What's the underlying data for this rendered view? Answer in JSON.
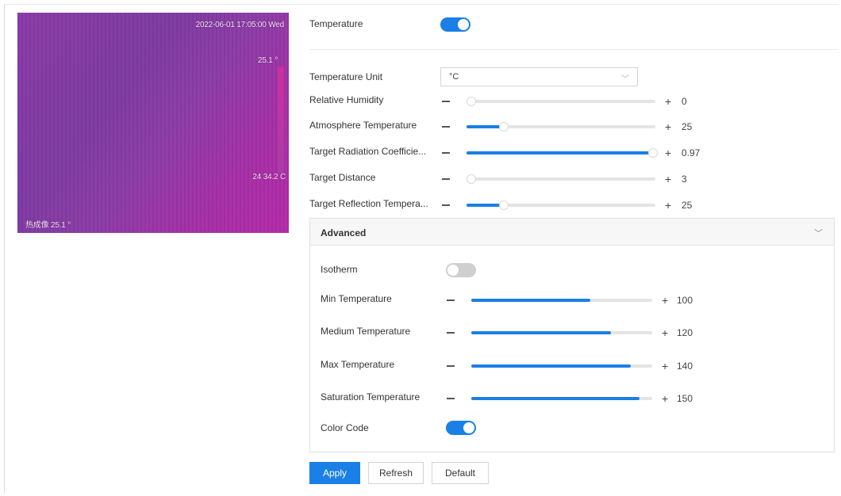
{
  "preview": {
    "timestamp": "2022-06-01 17:05:00 Wed",
    "max_reading": "25.1 °",
    "min_reading": "24 34.2 C",
    "point_label": "热成像 25.1 °"
  },
  "temperature": {
    "label": "Temperature",
    "enabled": true
  },
  "unit": {
    "label": "Temperature Unit",
    "value": "°C"
  },
  "sliders": [
    {
      "label": "Relative Humidity",
      "value": "0",
      "fraction": 0.0
    },
    {
      "label": "Atmosphere Temperature",
      "value": "25",
      "fraction": 0.18
    },
    {
      "label": "Target Radiation Coefficie...",
      "value": "0.97",
      "fraction": 0.97
    },
    {
      "label": "Target Distance",
      "value": "3",
      "fraction": 0.0
    },
    {
      "label": "Target Reflection Tempera...",
      "value": "25",
      "fraction": 0.18
    }
  ],
  "advanced": {
    "title": "Advanced",
    "isotherm": {
      "label": "Isotherm",
      "enabled": false
    },
    "sliders": [
      {
        "label": "Min Temperature",
        "value": "100",
        "fraction": 0.66
      },
      {
        "label": "Medium Temperature",
        "value": "120",
        "fraction": 0.77
      },
      {
        "label": "Max Temperature",
        "value": "140",
        "fraction": 0.88
      },
      {
        "label": "Saturation Temperature",
        "value": "150",
        "fraction": 0.93
      }
    ],
    "color_code": {
      "label": "Color Code",
      "enabled": true
    }
  },
  "buttons": {
    "apply": "Apply",
    "refresh": "Refresh",
    "default": "Default"
  },
  "colors": {
    "accent": "#1a7fe6",
    "thermal": "#8b3ca6"
  }
}
